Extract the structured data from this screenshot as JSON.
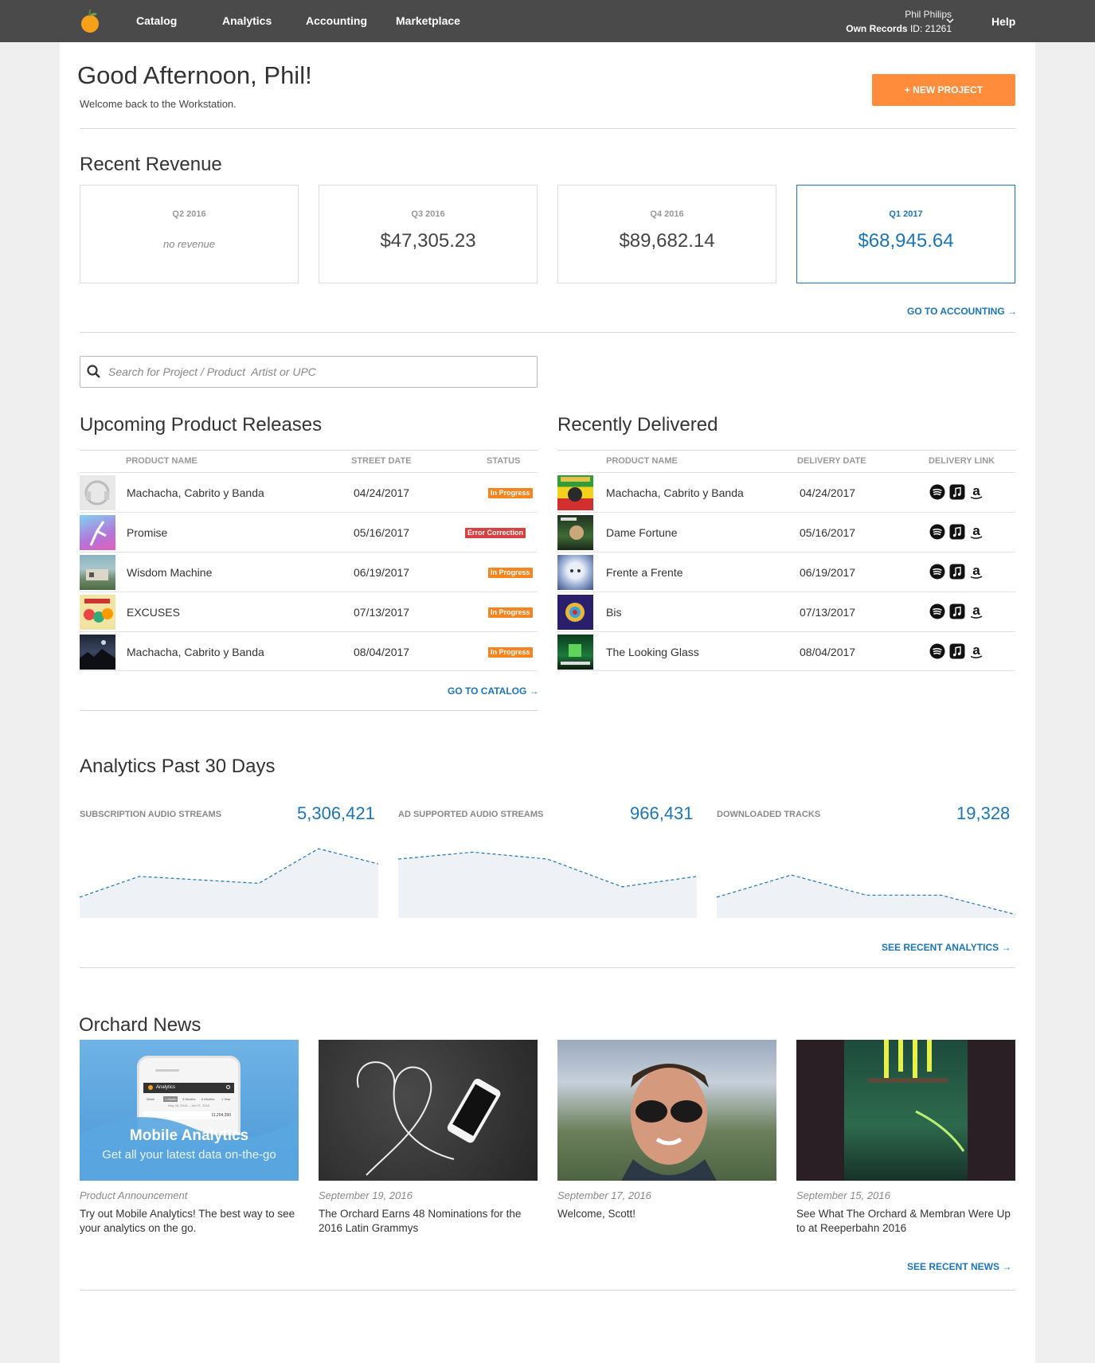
{
  "nav": {
    "items": [
      "Catalog",
      "Analytics",
      "Accounting",
      "Marketplace"
    ],
    "user_name": "Phil Philips",
    "account_name": "Own Records",
    "account_id": "ID: 21261",
    "help": "Help"
  },
  "header": {
    "greeting": "Good Afternoon, Phil!",
    "subtitle": "Welcome back to the Workstation.",
    "new_project": "+ NEW PROJECT"
  },
  "revenue": {
    "title": "Recent Revenue",
    "cards": [
      {
        "quarter": "Q2 2016",
        "value": "no revenue"
      },
      {
        "quarter": "Q3 2016",
        "value": "$47,305.23"
      },
      {
        "quarter": "Q4 2016",
        "value": "$89,682.14"
      },
      {
        "quarter": "Q1 2017",
        "value": "$68,945.64"
      }
    ],
    "link": "GO TO ACCOUNTING →"
  },
  "search": {
    "placeholder": "Search for Project / Product  Artist or UPC"
  },
  "upcoming": {
    "title": "Upcoming Product Releases",
    "columns": [
      "PRODUCT NAME",
      "STREET DATE",
      "STATUS"
    ],
    "rows": [
      {
        "name": "Machacha, Cabrito y Banda",
        "date": "04/24/2017",
        "status": "In Progress"
      },
      {
        "name": "Promise",
        "date": "05/16/2017",
        "status": "Error Correction"
      },
      {
        "name": "Wisdom Machine",
        "date": "06/19/2017",
        "status": "In Progress"
      },
      {
        "name": "EXCUSES",
        "date": "07/13/2017",
        "status": "In Progress"
      },
      {
        "name": "Machacha, Cabrito y Banda",
        "date": "08/04/2017",
        "status": "In Progress"
      }
    ],
    "link": "GO TO CATALOG →"
  },
  "delivered": {
    "title": "Recently Delivered",
    "columns": [
      "PRODUCT NAME",
      "DELIVERY DATE",
      "DELIVERY LINK"
    ],
    "rows": [
      {
        "name": "Machacha, Cabrito y Banda",
        "date": "04/24/2017"
      },
      {
        "name": "Dame Fortune",
        "date": "05/16/2017"
      },
      {
        "name": "Frente a Frente",
        "date": "06/19/2017"
      },
      {
        "name": "Bis",
        "date": "07/13/2017"
      },
      {
        "name": "The Looking Glass",
        "date": "08/04/2017"
      }
    ],
    "icons": [
      "spotify-icon",
      "itunes-icon",
      "amazon-icon"
    ]
  },
  "analytics": {
    "title": "Analytics Past 30 Days",
    "stats": [
      {
        "label": "SUBSCRIPTION AUDIO STREAMS",
        "value": "5,306,421",
        "trend": [
          0.3,
          0.6,
          0.55,
          0.5,
          1.0,
          0.78
        ]
      },
      {
        "label": "AD SUPPORTED AUDIO STREAMS",
        "value": "966,431",
        "trend": [
          0.85,
          0.95,
          0.85,
          0.45,
          0.6
        ]
      },
      {
        "label": "DOWNLOADED TRACKS",
        "value": "19,328",
        "trend": [
          0.3,
          0.62,
          0.33,
          0.33,
          0.05
        ]
      }
    ],
    "link": "SEE RECENT ANALYTICS →"
  },
  "news": {
    "title": "Orchard News",
    "items": [
      {
        "date": "Product Announcement",
        "title": "Try out Mobile Analytics! The best way to see your analytics on the go.",
        "img_title": "Mobile Analytics",
        "img_sub": "Get all your latest data on-the-go",
        "img_app": "Analytics",
        "img_tabs": [
          "Week",
          "1 Month",
          "3 Months",
          "6 Months",
          "1 Year"
        ],
        "img_range": "May 26, 2016 – Jun 07, 2016",
        "img_number": "11,204,390"
      },
      {
        "date": "September 19, 2016",
        "title": "The Orchard Earns 48 Nominations for the 2016 Latin Grammys"
      },
      {
        "date": "September 17, 2016",
        "title": "Welcome, Scott!"
      },
      {
        "date": "September 15, 2016",
        "title": "See What The Orchard & Membran Were Up to at Reeperbahn 2016"
      }
    ],
    "link": "SEE RECENT NEWS →"
  },
  "colors": {
    "accent": "#1b75bb",
    "orange": "#ff8c3a",
    "error": "#d64040",
    "topbar": "#4a4a4a"
  }
}
